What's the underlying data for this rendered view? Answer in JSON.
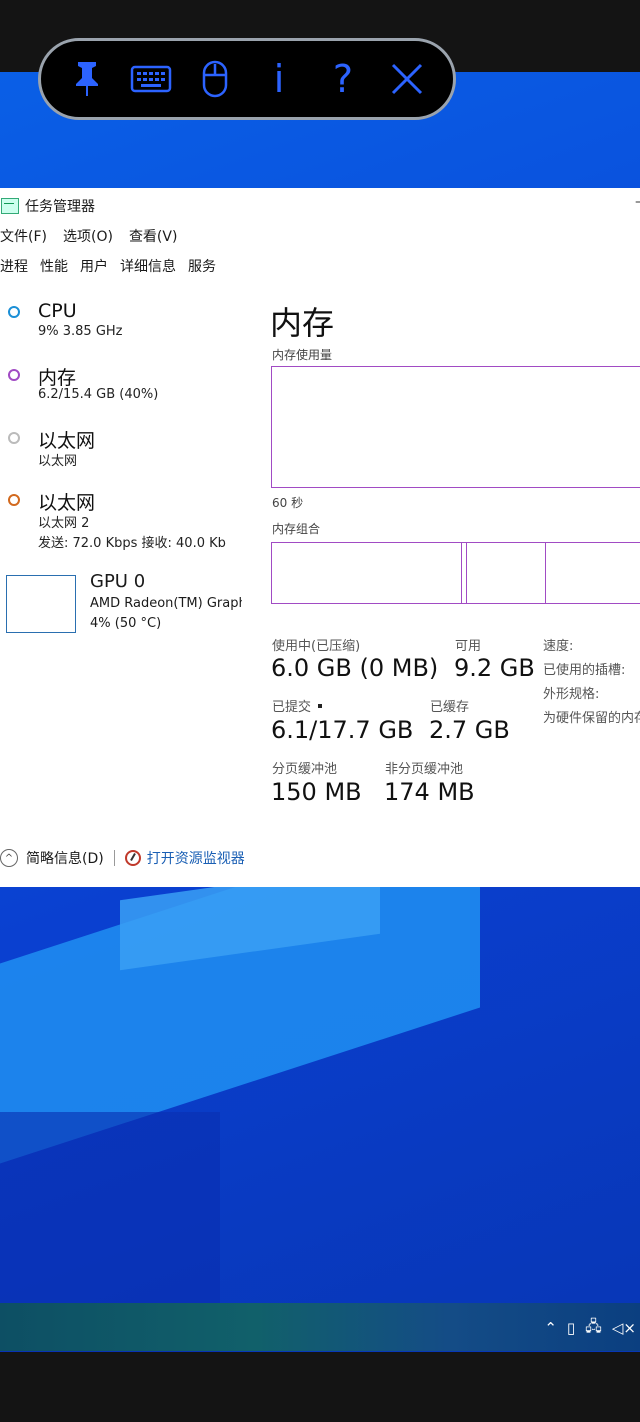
{
  "toolbar": {
    "icons": [
      "pin-icon",
      "keyboard-icon",
      "mouse-icon",
      "info-icon",
      "help-icon",
      "close-icon"
    ],
    "color": "#2c63ff"
  },
  "window": {
    "title": "任务管理器",
    "menu": [
      "文件(F)",
      "选项(O)",
      "查看(V)"
    ],
    "tabs": [
      "进程",
      "性能",
      "用户",
      "详细信息",
      "服务"
    ]
  },
  "sidebar": {
    "cpu": {
      "name": "CPU",
      "sub": "9% 3.85 GHz",
      "color": "#1b8fd6"
    },
    "memory": {
      "name": "内存",
      "sub": "6.2/15.4 GB (40%)",
      "color": "#a14bc4"
    },
    "ethernet1": {
      "name": "以太网",
      "sub": "以太网",
      "color": "#bbbbbb"
    },
    "ethernet2": {
      "name": "以太网",
      "sub": "以太网 2",
      "sub2": "发送: 72.0 Kbps 接收: 40.0 Kb",
      "color": "#d2691e"
    },
    "gpu": {
      "name": "GPU 0",
      "sub": "AMD Radeon(TM) Graphics",
      "sub2": "4% (50 °C)"
    }
  },
  "main": {
    "heading": "内存",
    "usage_label": "内存使用量",
    "time_label": "60 秒",
    "composition_label": "内存组合",
    "in_use_label": "使用中(已压缩)",
    "in_use_value": "6.0 GB (0 MB)",
    "available_label": "可用",
    "available_value": "9.2 GB",
    "committed_label": "已提交",
    "committed_value": "6.1/17.7 GB",
    "cached_label": "已缓存",
    "cached_value": "2.7 GB",
    "paged_label": "分页缓冲池",
    "paged_value": "150 MB",
    "nonpaged_label": "非分页缓冲池",
    "nonpaged_value": "174 MB",
    "speed_label": "速度:",
    "slots_label": "已使用的插槽:",
    "form_label": "外形规格:",
    "reserved_label": "为硬件保留的内存:"
  },
  "footer": {
    "summary": "简略信息(D)",
    "resource_monitor": "打开资源监视器"
  },
  "tray": [
    "chevron-up-icon",
    "tablet-icon",
    "network-icon",
    "volume-icon"
  ]
}
